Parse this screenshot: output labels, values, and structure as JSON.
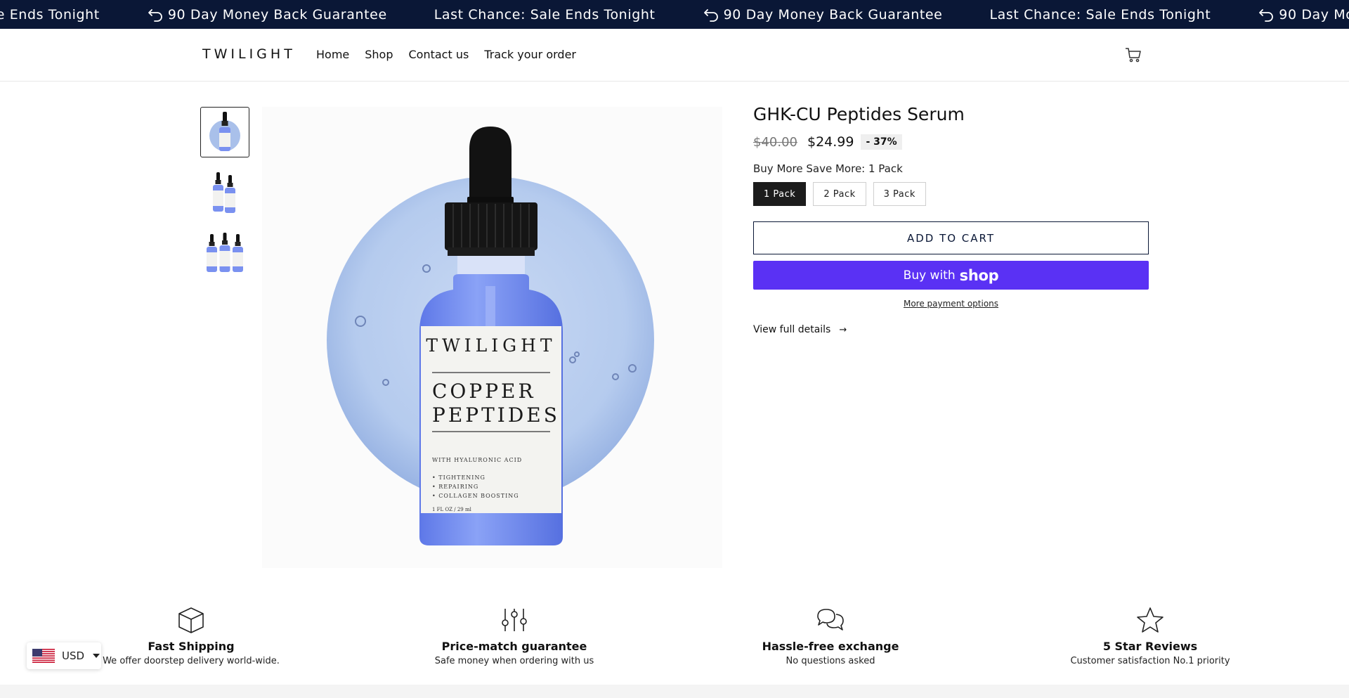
{
  "announcement": {
    "items": [
      {
        "text": "Last Chance: Sale Ends Tonight",
        "icon": ""
      },
      {
        "text": "90 Day Money Back Guarantee",
        "icon": "return-arrow-icon"
      },
      {
        "text": "Last Chance: Sale Ends Tonight",
        "icon": ""
      },
      {
        "text": "90 Day Money Back Guarantee",
        "icon": "return-arrow-icon"
      },
      {
        "text": "Last Chance: Sale Ends Tonight",
        "icon": ""
      },
      {
        "text": "90 Day Money Back Guarantee",
        "icon": "return-arrow-icon"
      }
    ],
    "background": "#0a1736"
  },
  "header": {
    "logo": "TWILIGHT",
    "nav": [
      "Home",
      "Shop",
      "Contact us",
      "Track your order"
    ],
    "cart_icon": "cart-icon"
  },
  "product": {
    "title": "GHK-CU Peptides Serum",
    "compare_price": "$40.00",
    "price": "$24.99",
    "discount_badge": "- 37%",
    "variant_label": "Buy More Save More: 1 Pack",
    "variants": [
      "1 Pack",
      "2 Pack",
      "3 Pack"
    ],
    "selected_variant": "1 Pack",
    "add_to_cart": "ADD TO CART",
    "buy_with": "Buy with",
    "buy_brand": "shop",
    "more_payment": "More payment options",
    "view_full": "View full details",
    "view_full_arrow": "→",
    "thumbnail_counts": [
      1,
      2,
      3
    ],
    "bottle_label": {
      "brand": "TWILIGHT",
      "name_line1": "COPPER",
      "name_line2": "PEPTIDES",
      "subtitle": "WITH HYALURONIC ACID",
      "bullets": [
        "• TIGHTENING",
        "• REPAIRING",
        "• COLLAGEN BOOSTING"
      ],
      "volume": "1 FL OZ / 29 ml"
    },
    "accent_color": "#5a31f4"
  },
  "features": [
    {
      "icon": "box-icon",
      "title": "Fast Shipping",
      "desc": "We offer doorstep delivery world-wide."
    },
    {
      "icon": "sliders-icon",
      "title": "Price-match guarantee",
      "desc": "Safe money when ordering with us"
    },
    {
      "icon": "chat-bubbles-icon",
      "title": "Hassle-free exchange",
      "desc": "No questions asked"
    },
    {
      "icon": "star-icon",
      "title": "5 Star Reviews",
      "desc": "Customer satisfaction No.1 priority"
    }
  ],
  "currency": {
    "code": "USD",
    "flag_icon": "us-flag-icon"
  }
}
